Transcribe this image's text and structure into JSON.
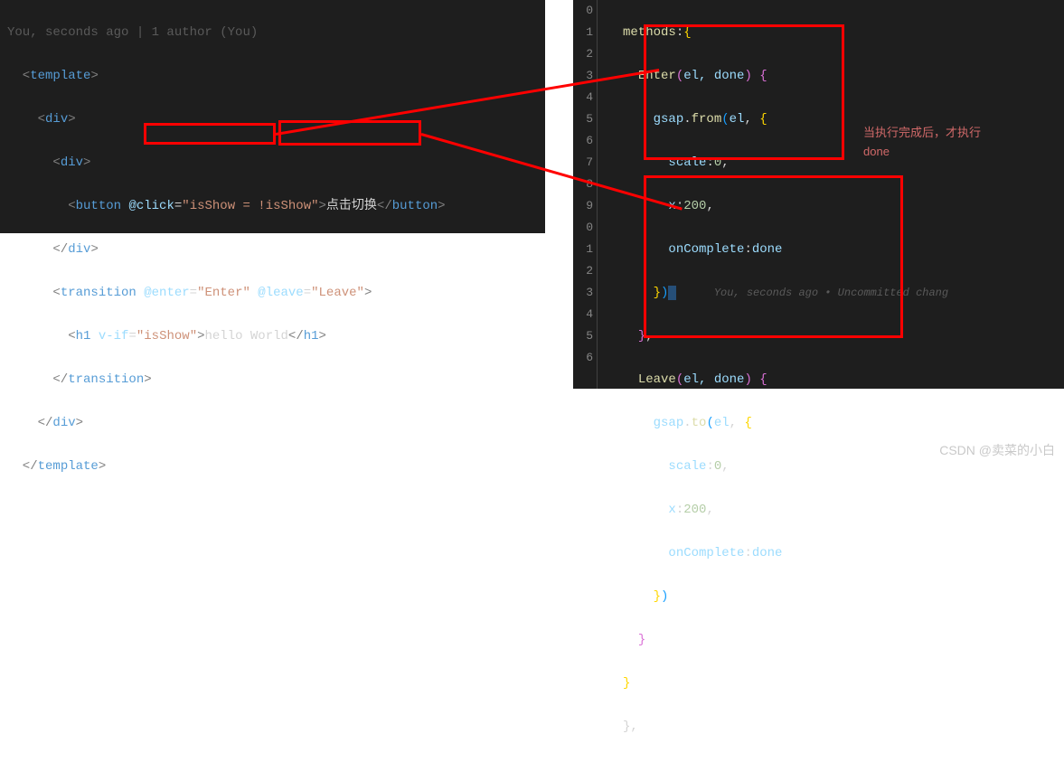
{
  "left_panel": {
    "header_faded": "You, seconds ago | 1 author (You)",
    "lines": {
      "l1": {
        "tag": "template"
      },
      "l2": {
        "tag": "div"
      },
      "l3": {
        "tag": "div"
      },
      "l4": {
        "tag": "button",
        "attr": "@click",
        "val": "isShow = !isShow",
        "text": "点击切换"
      },
      "l5": {
        "close": "div"
      },
      "l6": {
        "tag": "transition",
        "attr1": "@enter",
        "val1": "Enter",
        "attr2": "@leave",
        "val2": "Leave"
      },
      "l7": {
        "tag": "h1",
        "attr": "v-if",
        "val": "isShow",
        "text": "hello World"
      },
      "l8": {
        "close": "transition"
      },
      "l9": {
        "close": "div"
      },
      "l10": {
        "close": "template"
      }
    }
  },
  "right_panel": {
    "line_numbers": [
      "0",
      "1",
      "2",
      "3",
      "4",
      "5",
      "6",
      "7",
      "8",
      "9",
      "0",
      "1",
      "2",
      "3",
      "4",
      "5",
      "6"
    ],
    "code": {
      "methods": "methods",
      "enter_fn": "Enter",
      "leave_fn": "Leave",
      "params": "el, done",
      "gsap": "gsap",
      "from": "from",
      "to": "to",
      "el": "el",
      "scale": "scale",
      "scale_val": "0",
      "x": "x",
      "x_val": "200",
      "onComplete": "onComplete",
      "done": "done"
    },
    "inline_hint": "You, seconds ago • Uncommitted chang"
  },
  "annotations": {
    "line1": "当执行完成后，才执行",
    "line2": "done"
  },
  "watermark": "CSDN @卖菜的小白"
}
